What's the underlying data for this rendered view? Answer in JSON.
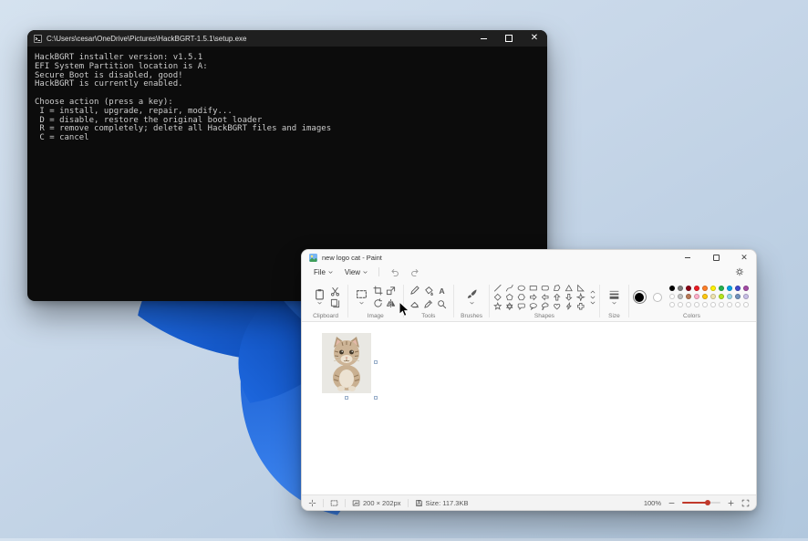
{
  "console": {
    "title": "C:\\Users\\cesar\\OneDrive\\Pictures\\HackBGRT-1.5.1\\setup.exe",
    "lines": [
      "HackBGRT installer version: v1.5.1",
      "EFI System Partition location is A:",
      "Secure Boot is disabled, good!",
      "HackBGRT is currently enabled.",
      "",
      "Choose action (press a key):",
      " I = install, upgrade, repair, modify...",
      " D = disable, restore the original boot loader",
      " R = remove completely; delete all HackBGRT files and images",
      " C = cancel"
    ]
  },
  "paint": {
    "title": "new logo cat - Paint",
    "menu": {
      "file": "File",
      "view": "View"
    },
    "groups": {
      "clipboard": "Clipboard",
      "image": "Image",
      "tools": "Tools",
      "brushes": "Brushes",
      "shapes": "Shapes",
      "size": "Size",
      "colors": "Colors"
    },
    "clipboard_tools": [
      "paste",
      "cut",
      "copy"
    ],
    "image_tools": [
      "select",
      "crop",
      "resize",
      "rotate",
      "flip"
    ],
    "tools": [
      "pencil",
      "fill",
      "text",
      "eraser",
      "color-picker",
      "magnifier"
    ],
    "brush_tool": "brush",
    "shapes": [
      "line",
      "curve",
      "oval",
      "rectangle",
      "rounded-rectangle",
      "polygon",
      "triangle",
      "right-triangle",
      "diamond",
      "pentagon",
      "hexagon",
      "right-arrow",
      "left-arrow",
      "up-arrow",
      "down-arrow",
      "four-point-star",
      "five-point-star",
      "six-point-star",
      "rounded-callout",
      "oval-callout",
      "cloud-callout",
      "heart",
      "lightning",
      "cross"
    ],
    "colors": {
      "color1": "#000000",
      "color2": "#FFFFFF",
      "swatches": [
        [
          "#000000",
          "#7F7F7F",
          "#880015",
          "#ED1C24",
          "#FF7F27",
          "#FFF200",
          "#22B14C",
          "#00A2E8",
          "#3F48CC",
          "#A349A4"
        ],
        [
          "#FFFFFF",
          "#C3C3C3",
          "#B97A57",
          "#FFAEC9",
          "#FFC90E",
          "#EFE4B0",
          "#B5E61D",
          "#99D9EA",
          "#7092BE",
          "#C8BFE7"
        ],
        [
          "#FFFFFF",
          "#FFFFFF",
          "#FFFFFF",
          "#FFFFFF",
          "#FFFFFF",
          "#FFFFFF",
          "#FFFFFF",
          "#FFFFFF",
          "#FFFFFF",
          "#FFFFFF"
        ]
      ]
    },
    "status": {
      "canvas_size": "200 × 202px",
      "file_size": "Size: 117.3KB",
      "zoom": "100%"
    },
    "accent_color": "#c0392b"
  }
}
